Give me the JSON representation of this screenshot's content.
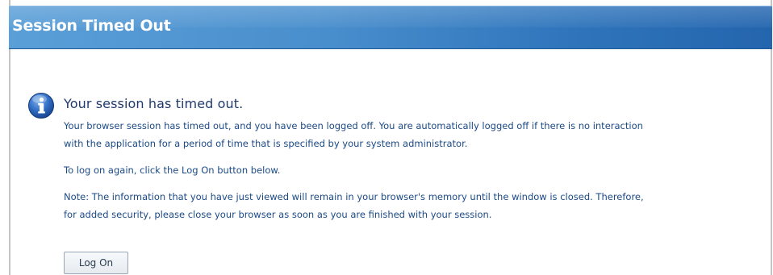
{
  "header": {
    "title": "Session Timed Out"
  },
  "message": {
    "icon": "info-icon",
    "heading": "Your session has timed out.",
    "paragraph1_line1": "Your browser session has timed out, and you have been logged off. You are automatically logged off if there is no interaction",
    "paragraph1_line2": "with the application for a period of time that is specified by your system administrator.",
    "paragraph2": "To log on again, click the Log On button below.",
    "paragraph3_line1": "Note: The information that you have just viewed will remain in your browser's memory until the window is closed. Therefore,",
    "paragraph3_line2": "for added security, please close your browser as soon as you are finished with your session."
  },
  "actions": {
    "logon_label": "Log On"
  },
  "colors": {
    "header_blue": "#2f74bb",
    "heading_text": "#1f3a6e",
    "body_text": "#1b4a87"
  }
}
